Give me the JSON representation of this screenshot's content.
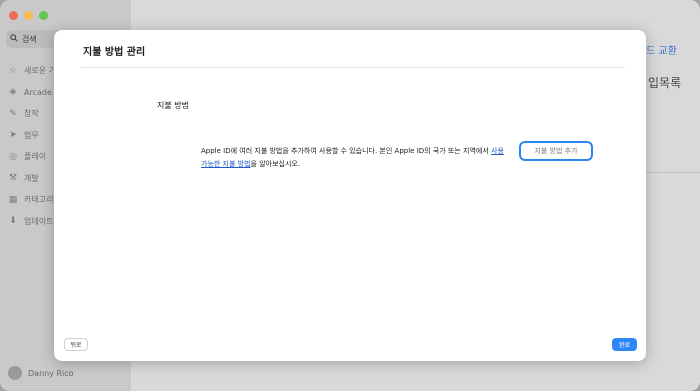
{
  "sidebar": {
    "search_label": "검색",
    "items": [
      {
        "icon": "star-icon",
        "label": "새로운 기능"
      },
      {
        "icon": "arcade-icon",
        "label": "Arcade"
      },
      {
        "icon": "rocket-icon",
        "label": "창작"
      },
      {
        "icon": "paper-plane-icon",
        "label": "업무"
      },
      {
        "icon": "game-controller-icon",
        "label": "플레이"
      },
      {
        "icon": "hammer-icon",
        "label": "개발"
      },
      {
        "icon": "grid-icon",
        "label": "카테고리"
      },
      {
        "icon": "download-icon",
        "label": "업데이트"
      }
    ],
    "user_name": "Danny Rico"
  },
  "background": {
    "link_partial": "드 교환",
    "heading_partial": "입목록"
  },
  "sheet": {
    "title": "지불 방법 관리",
    "section_title": "지불 방법",
    "description_part1": "Apple ID에 여러 지불 방법을 추가하여 사용할 수 있습니다. 본인 Apple ID의 국가 또는 지역에서 ",
    "description_link": "사용 가능한 지불 방법",
    "description_part2": "을 알아보십시오.",
    "add_button": "지불 방법 추가",
    "back_button": "뒤로",
    "done_button": "완료"
  },
  "colors": {
    "accent": "#2F86F6",
    "link": "#2157C7"
  }
}
